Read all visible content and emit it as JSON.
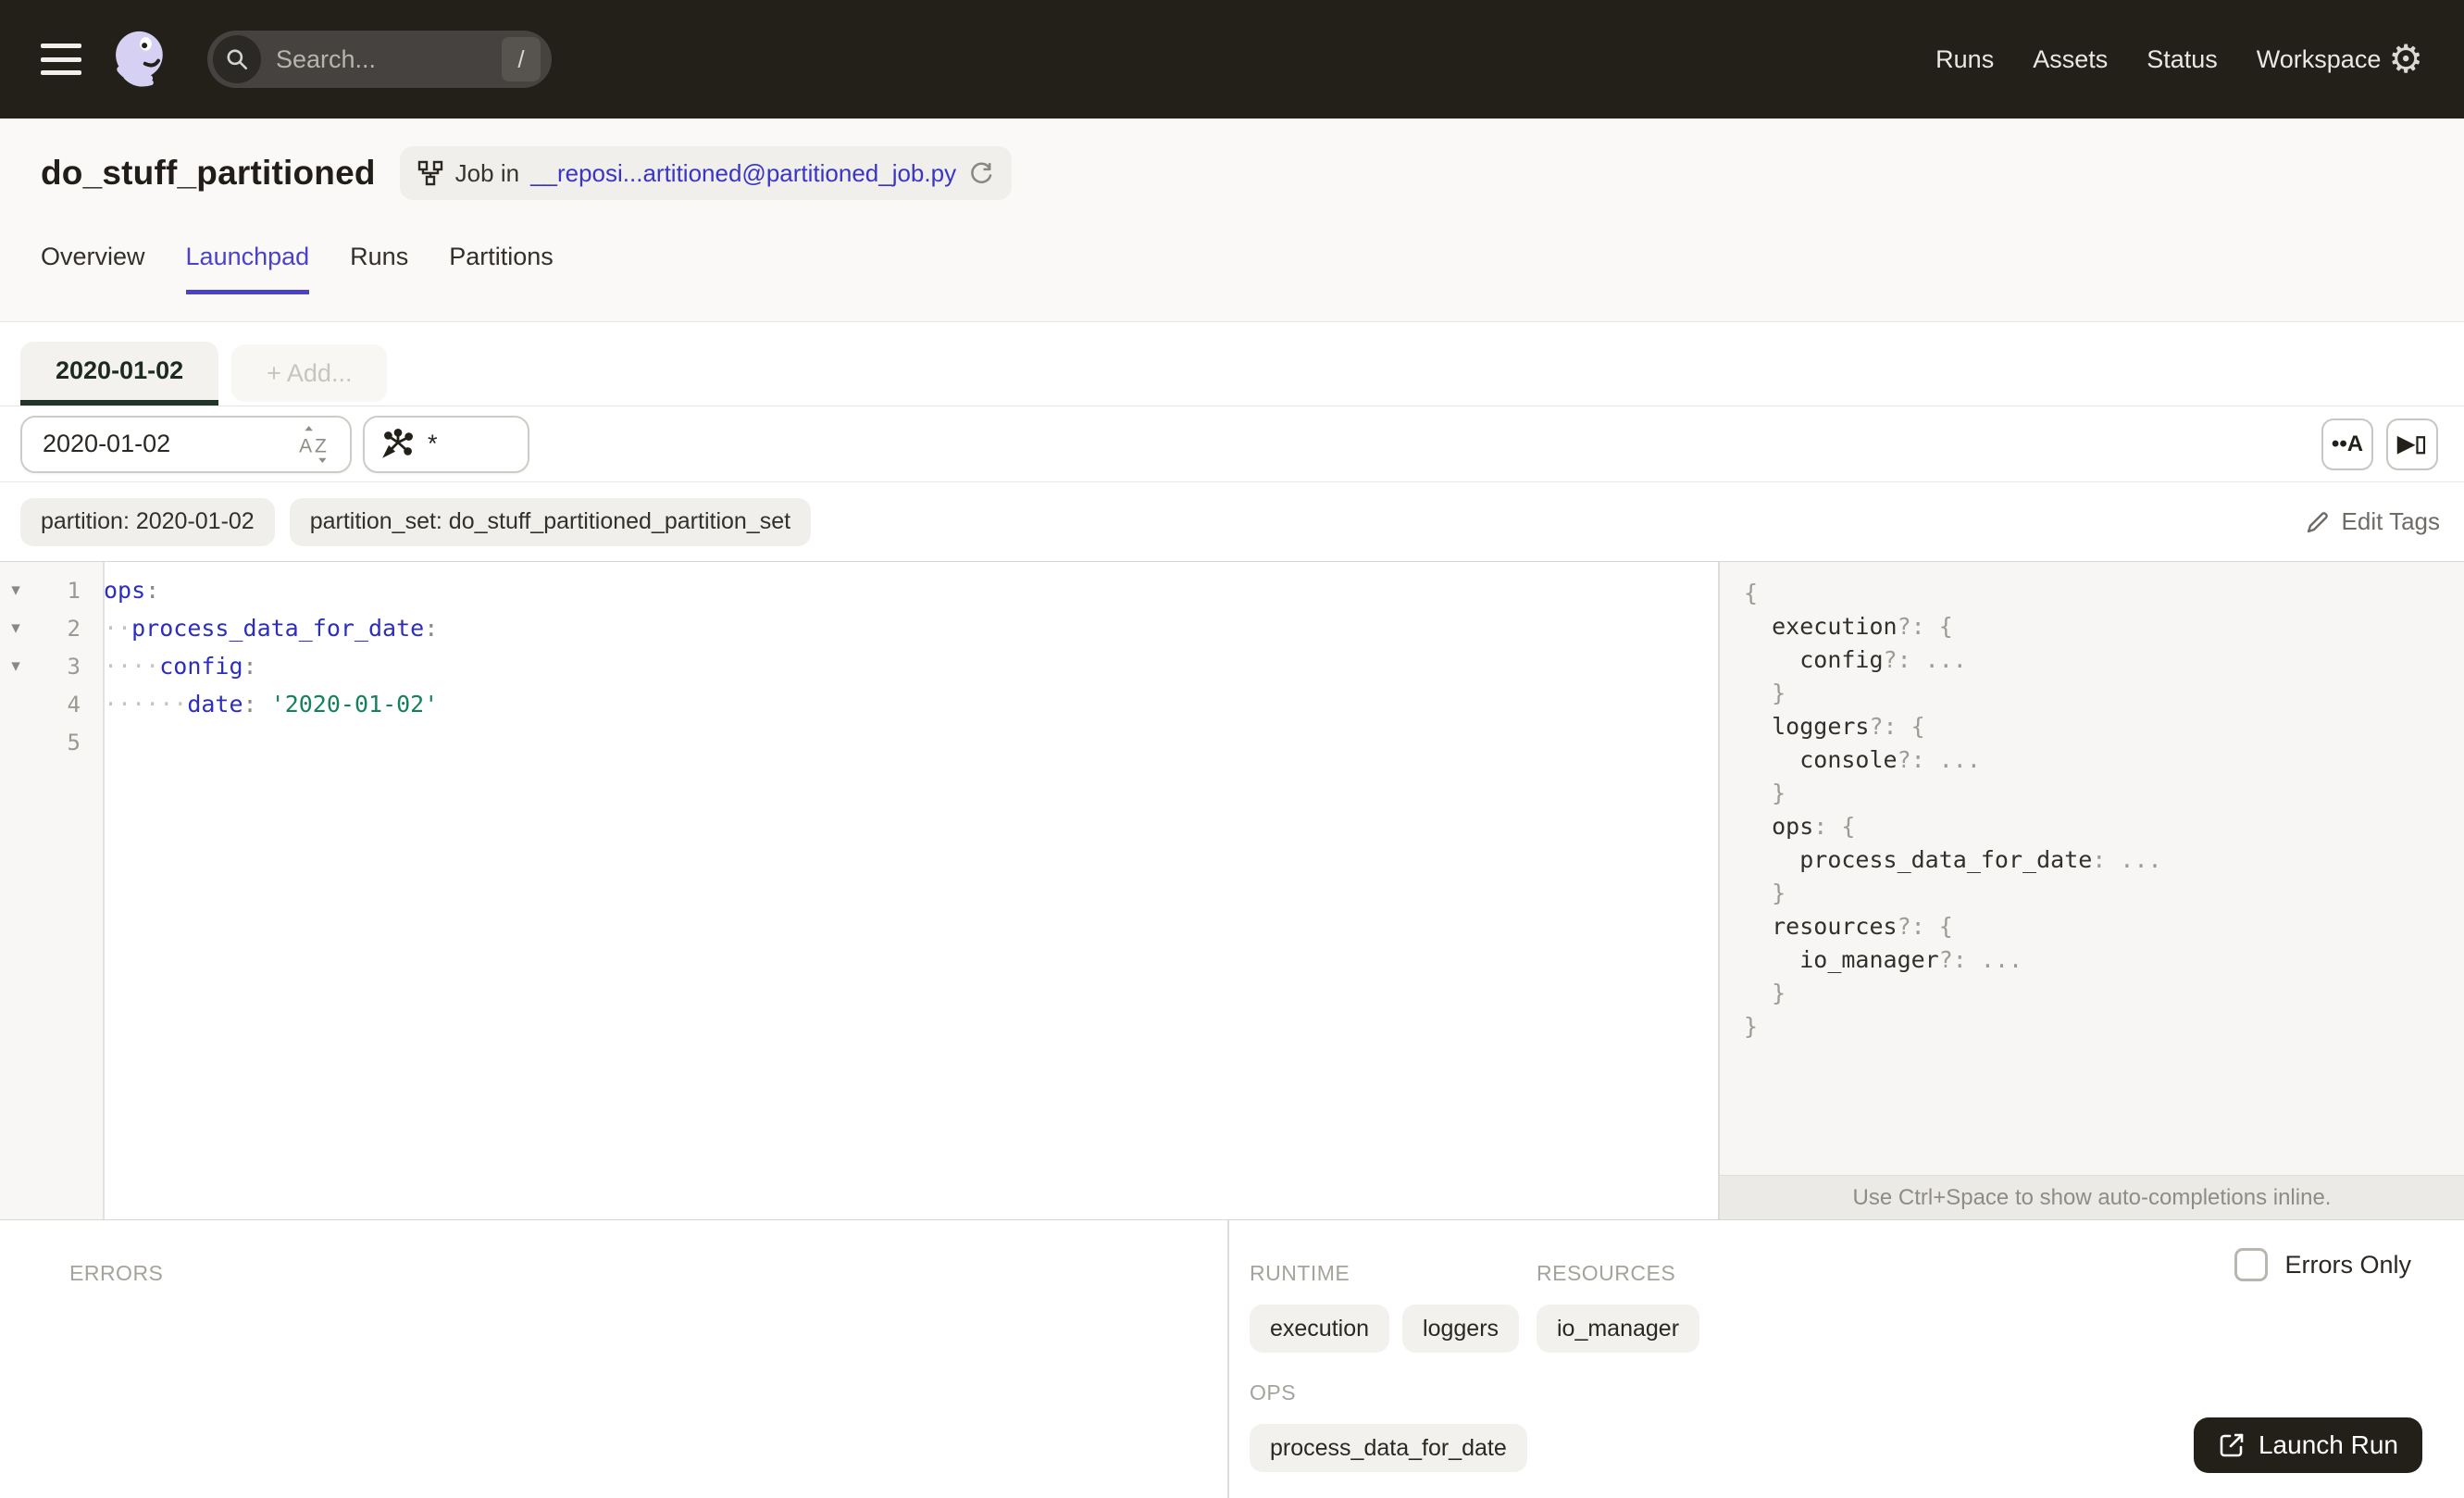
{
  "topbar": {
    "search": {
      "placeholder": "Search...",
      "shortcut": "/"
    },
    "nav_items": [
      "Runs",
      "Assets",
      "Status",
      "Workspace"
    ]
  },
  "header": {
    "title": "do_stuff_partitioned",
    "job_badge": {
      "prefix": "Job in",
      "link": "__reposi...artitioned@partitioned_job.py"
    },
    "tabs": [
      {
        "label": "Overview",
        "active": false
      },
      {
        "label": "Launchpad",
        "active": true
      },
      {
        "label": "Runs",
        "active": false
      },
      {
        "label": "Partitions",
        "active": false
      }
    ]
  },
  "launchpad": {
    "config_tabs": [
      {
        "label": "2020-01-02",
        "active": true
      },
      {
        "label": "+ Add...",
        "active": false
      }
    ],
    "partition_input": {
      "value": "2020-01-02"
    },
    "op_selector": {
      "value": "*"
    },
    "toolbar_buttons": [
      {
        "icon": "show-whitespace-icon",
        "glyph": "••A"
      },
      {
        "icon": "scaffold-config-icon",
        "glyph": "▶▯"
      }
    ],
    "tags": [
      "partition: 2020-01-02",
      "partition_set: do_stuff_partitioned_partition_set"
    ],
    "edit_tags_label": "Edit Tags",
    "editor_lines": [
      {
        "num": "1",
        "fold": true,
        "tokens": [
          {
            "t": "key",
            "v": "ops"
          },
          {
            "t": "punc",
            "v": ":"
          }
        ]
      },
      {
        "num": "2",
        "fold": true,
        "tokens": [
          {
            "t": "ws",
            "v": "··"
          },
          {
            "t": "key",
            "v": "process_data_for_date"
          },
          {
            "t": "punc",
            "v": ":"
          }
        ]
      },
      {
        "num": "3",
        "fold": true,
        "tokens": [
          {
            "t": "ws",
            "v": "····"
          },
          {
            "t": "key",
            "v": "config"
          },
          {
            "t": "punc",
            "v": ":"
          }
        ]
      },
      {
        "num": "4",
        "fold": false,
        "tokens": [
          {
            "t": "ws",
            "v": "······"
          },
          {
            "t": "key",
            "v": "date"
          },
          {
            "t": "punc",
            "v": ":"
          },
          {
            "t": "plain",
            "v": " "
          },
          {
            "t": "str",
            "v": "'2020-01-02'"
          }
        ]
      },
      {
        "num": "5",
        "fold": false,
        "tokens": []
      }
    ],
    "schema_lines": [
      [
        {
          "t": "punc",
          "v": "{"
        }
      ],
      [
        {
          "t": "plain",
          "v": "  "
        },
        {
          "t": "key",
          "v": "execution"
        },
        {
          "t": "punc",
          "v": "?: {"
        }
      ],
      [
        {
          "t": "plain",
          "v": "    "
        },
        {
          "t": "key",
          "v": "config"
        },
        {
          "t": "punc",
          "v": "?: ..."
        }
      ],
      [
        {
          "t": "plain",
          "v": "  "
        },
        {
          "t": "punc",
          "v": "}"
        }
      ],
      [
        {
          "t": "plain",
          "v": "  "
        },
        {
          "t": "key",
          "v": "loggers"
        },
        {
          "t": "punc",
          "v": "?: {"
        }
      ],
      [
        {
          "t": "plain",
          "v": "    "
        },
        {
          "t": "key",
          "v": "console"
        },
        {
          "t": "punc",
          "v": "?: ..."
        }
      ],
      [
        {
          "t": "plain",
          "v": "  "
        },
        {
          "t": "punc",
          "v": "}"
        }
      ],
      [
        {
          "t": "plain",
          "v": "  "
        },
        {
          "t": "key",
          "v": "ops"
        },
        {
          "t": "punc",
          "v": ": {"
        }
      ],
      [
        {
          "t": "plain",
          "v": "    "
        },
        {
          "t": "key",
          "v": "process_data_for_date"
        },
        {
          "t": "punc",
          "v": ": ..."
        }
      ],
      [
        {
          "t": "plain",
          "v": "  "
        },
        {
          "t": "punc",
          "v": "}"
        }
      ],
      [
        {
          "t": "plain",
          "v": "  "
        },
        {
          "t": "key",
          "v": "resources"
        },
        {
          "t": "punc",
          "v": "?: {"
        }
      ],
      [
        {
          "t": "plain",
          "v": "    "
        },
        {
          "t": "key",
          "v": "io_manager"
        },
        {
          "t": "punc",
          "v": "?: ..."
        }
      ],
      [
        {
          "t": "plain",
          "v": "  "
        },
        {
          "t": "punc",
          "v": "}"
        }
      ],
      [
        {
          "t": "punc",
          "v": "}"
        }
      ]
    ],
    "hint": "Use Ctrl+Space to show auto-completions inline."
  },
  "bottom": {
    "errors_label": "ERRORS",
    "errors_only_label": "Errors Only",
    "groups": [
      {
        "label": "RUNTIME",
        "chips": [
          "execution",
          "loggers"
        ]
      },
      {
        "label": "RESOURCES",
        "chips": [
          "io_manager"
        ]
      },
      {
        "label": "OPS",
        "chips": [
          "process_data_for_date"
        ]
      }
    ],
    "launch_button": "Launch Run"
  },
  "colors": {
    "accent": "#4a43c8",
    "link": "#3a35c5",
    "topbar_bg": "#232019",
    "code_key": "#2d2dbe",
    "code_string": "#15815a",
    "active_tab_underline": "#21342a"
  }
}
